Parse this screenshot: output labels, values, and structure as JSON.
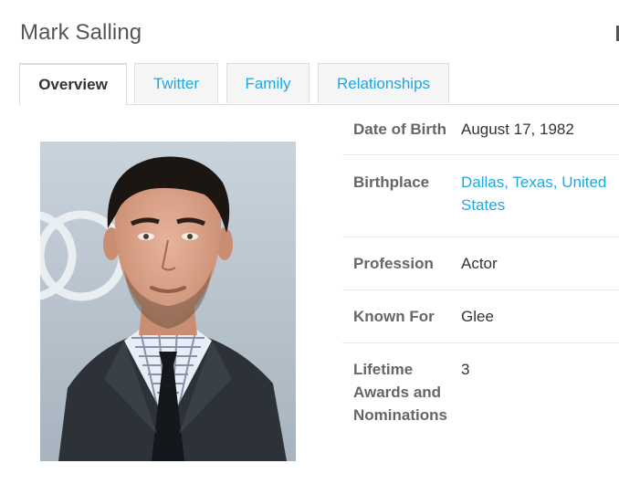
{
  "page": {
    "title": "Mark Salling"
  },
  "tabs": [
    {
      "label": "Overview",
      "active": true
    },
    {
      "label": "Twitter",
      "active": false
    },
    {
      "label": "Family",
      "active": false
    },
    {
      "label": "Relationships",
      "active": false
    }
  ],
  "facts": [
    {
      "label": "Date of Birth",
      "value": "August 17, 1982"
    },
    {
      "label": "Birthplace",
      "value": "Dallas, Texas, United States",
      "is_link": true
    },
    {
      "label": "Profession",
      "value": "Actor"
    },
    {
      "label": "Known For",
      "value": "Glee"
    },
    {
      "label": "Lifetime Awards and Nominations",
      "value": "3"
    }
  ],
  "colors": {
    "link": "#1ea7e1",
    "label": "#666666",
    "divider": "#e6e6e6"
  }
}
